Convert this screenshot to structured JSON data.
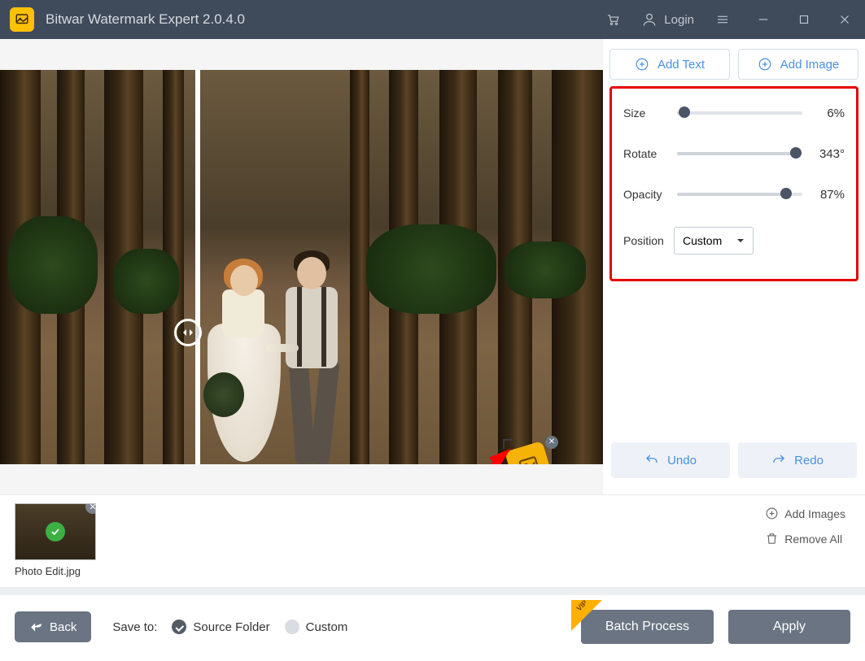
{
  "titlebar": {
    "app_title": "Bitwar Watermark Expert  2.0.4.0",
    "login_label": "Login"
  },
  "side": {
    "add_text_label": "Add Text",
    "add_image_label": "Add Image",
    "size_label": "Size",
    "size_value": "6%",
    "size_percent": 6,
    "rotate_label": "Rotate",
    "rotate_value": "343°",
    "rotate_percent": 95,
    "opacity_label": "Opacity",
    "opacity_value": "87%",
    "opacity_percent": 87,
    "position_label": "Position",
    "position_selected": "Custom",
    "undo_label": "Undo",
    "redo_label": "Redo"
  },
  "strip": {
    "thumb_name": "Photo Edit.jpg",
    "add_images_label": "Add Images",
    "remove_all_label": "Remove All"
  },
  "footer": {
    "back_label": "Back",
    "save_to_label": "Save to:",
    "source_folder_label": "Source Folder",
    "custom_label": "Custom",
    "batch_label": "Batch Process",
    "apply_label": "Apply",
    "vip_text": "VIP"
  }
}
